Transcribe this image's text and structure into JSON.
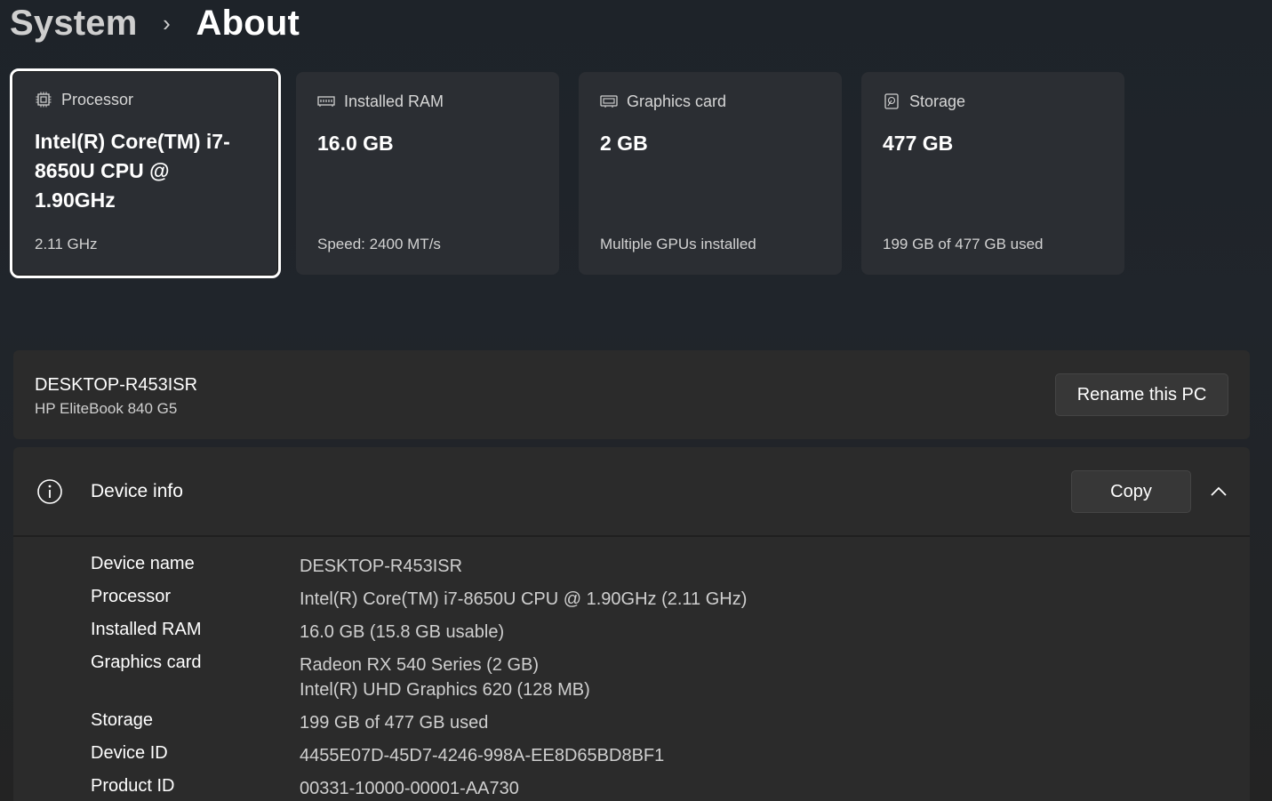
{
  "breadcrumb": {
    "parent": "System",
    "separator": "›",
    "current": "About"
  },
  "cards": [
    {
      "title": "Processor",
      "icon": "processor-chip-icon",
      "value": "Intel(R) Core(TM) i7-8650U CPU @ 1.90GHz",
      "sub": "2.11 GHz",
      "selected": true
    },
    {
      "title": "Installed RAM",
      "icon": "memory-icon",
      "value": "16.0 GB",
      "sub": "Speed: 2400 MT/s"
    },
    {
      "title": "Graphics card",
      "icon": "graphics-card-icon",
      "value": "2 GB",
      "sub": "Multiple GPUs installed"
    },
    {
      "title": "Storage",
      "icon": "storage-drive-icon",
      "value": "477 GB",
      "sub": "199 GB of 477 GB used"
    }
  ],
  "pc": {
    "name": "DESKTOP-R453ISR",
    "model": "HP EliteBook 840 G5",
    "rename_label": "Rename this PC"
  },
  "device_info": {
    "title": "Device info",
    "copy_label": "Copy",
    "rows": [
      {
        "key": "Device name",
        "value": [
          "DESKTOP-R453ISR"
        ]
      },
      {
        "key": "Processor",
        "value": [
          "Intel(R) Core(TM) i7-8650U CPU @ 1.90GHz (2.11 GHz)"
        ]
      },
      {
        "key": "Installed RAM",
        "value": [
          "16.0 GB (15.8 GB usable)"
        ]
      },
      {
        "key": "Graphics card",
        "value": [
          "Radeon RX 540 Series (2 GB)",
          "Intel(R) UHD Graphics 620 (128 MB)"
        ]
      },
      {
        "key": "Storage",
        "value": [
          "199 GB of 477 GB used"
        ]
      },
      {
        "key": "Device ID",
        "value": [
          "4455E07D-45D7-4246-998A-EE8D65BD8BF1"
        ]
      },
      {
        "key": "Product ID",
        "value": [
          "00331-10000-00001-AA730"
        ]
      }
    ]
  }
}
